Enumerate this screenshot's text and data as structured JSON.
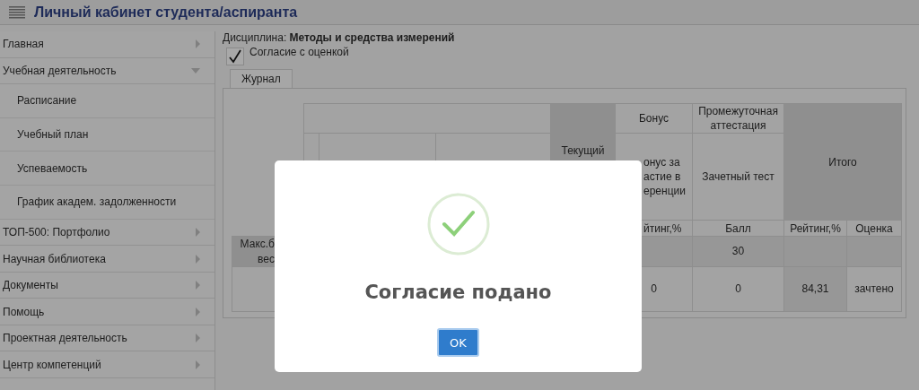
{
  "header": {
    "title": "Личный кабинет студента/аспиранта"
  },
  "sidebar": {
    "items": [
      {
        "label": "Главная",
        "expanded": false
      },
      {
        "label": "Учебная деятельность",
        "expanded": true,
        "children": [
          {
            "label": "Расписание"
          },
          {
            "label": "Учебный план"
          },
          {
            "label": "Успеваемость"
          },
          {
            "label": "График академ. задолженности"
          }
        ]
      },
      {
        "label": "ТОП-500: Портфолио",
        "expanded": false
      },
      {
        "label": "Научная библиотека",
        "expanded": false
      },
      {
        "label": "Документы",
        "expanded": false
      },
      {
        "label": "Помощь",
        "expanded": false
      },
      {
        "label": "Проектная деятельность",
        "expanded": false
      },
      {
        "label": "Центр компетенций",
        "expanded": false
      }
    ]
  },
  "discipline": {
    "label": "Дисциплина:",
    "value": "Методы и средства измерений"
  },
  "consent": {
    "label": "Согласие с оценкой",
    "checked": true
  },
  "tabs": [
    {
      "label": "Журнал",
      "selected": true
    }
  ],
  "table": {
    "current_header": "Текущий",
    "bonus_header": "Бонус",
    "interim_header": "Промежуточная аттестация",
    "total_header": "Итого",
    "bonus_sub_lines": [
      "онус за",
      "астие в",
      "еренции"
    ],
    "test_header": "Зачетный тест",
    "bonus_unit": "йтинг,%",
    "test_unit": "Балл",
    "total_unit": "Рейтинг,%",
    "grade_unit": "Оценка",
    "max_label_lines": [
      "Макс.б",
      "вес"
    ],
    "max_test": "30",
    "row": {
      "bonus": "0",
      "test": "0",
      "total": "84,31",
      "grade": "зачтено"
    }
  },
  "dialog": {
    "message": "Согласие подано",
    "button": "OK"
  }
}
